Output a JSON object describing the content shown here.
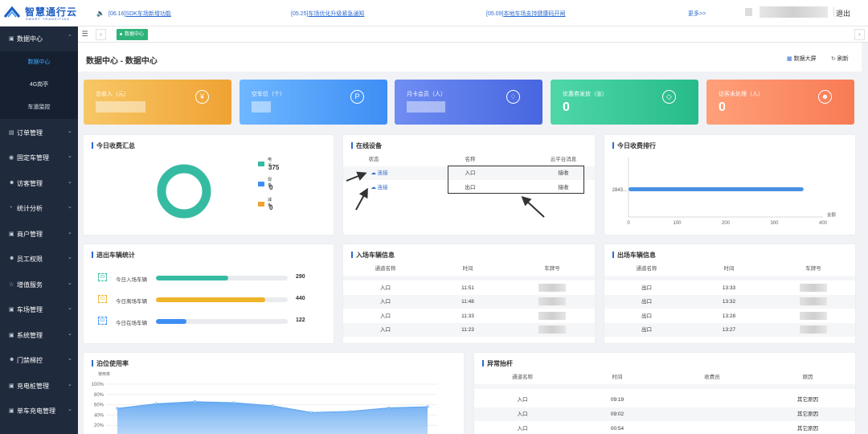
{
  "brand": {
    "name": "智慧通行云",
    "tagline": "SMART TRANSITING"
  },
  "notices": [
    {
      "date": "[06.16]",
      "text": "SDK车场新增功能"
    },
    {
      "date": "[05.25]",
      "text": "车场优化升级紧急通知"
    },
    {
      "date": "[05.09]",
      "text": "本地车场支持健康码开闸"
    }
  ],
  "header": {
    "more_label": "更多>>",
    "logout_label": "退出"
  },
  "sidebar": {
    "groups": [
      {
        "label": "数据中心",
        "icon": "chart-icon",
        "expanded": true,
        "children": [
          {
            "label": "数据中心",
            "active": true
          },
          {
            "label": "4G岗亭"
          },
          {
            "label": "车道监控"
          }
        ]
      },
      {
        "label": "订单管理",
        "icon": "order-icon"
      },
      {
        "label": "固定车管理",
        "icon": "car-icon"
      },
      {
        "label": "访客管理",
        "icon": "visitor-icon"
      },
      {
        "label": "统计分析",
        "icon": "stats-icon"
      },
      {
        "label": "商户管理",
        "icon": "store-icon"
      },
      {
        "label": "员工权限",
        "icon": "staff-icon"
      },
      {
        "label": "增值服务",
        "icon": "star-icon"
      },
      {
        "label": "车场管理",
        "icon": "parking-icon"
      },
      {
        "label": "系统管理",
        "icon": "system-icon"
      },
      {
        "label": "门禁梯控",
        "icon": "door-icon"
      },
      {
        "label": "充电桩管理",
        "icon": "charger-icon"
      },
      {
        "label": "单车充电管理",
        "icon": "bike-icon"
      }
    ]
  },
  "tabbar": {
    "active_tab": "数据中心"
  },
  "page": {
    "title": "数据中心 - 数据中心",
    "big_screen_label": "数据大屏",
    "refresh_label": "刷新"
  },
  "stats": [
    {
      "title": "总收入（元）",
      "value": "",
      "icon": "yen-icon",
      "color_from": "#f7c766",
      "color_to": "#f0a233"
    },
    {
      "title": "空车位（个）",
      "value": "",
      "icon": "parking-p-icon",
      "color_from": "#6fb7ff",
      "color_to": "#3d8ef5"
    },
    {
      "title": "月卡会员（人）",
      "value": "",
      "icon": "vip-icon",
      "color_from": "#6f8df2",
      "color_to": "#4766e0"
    },
    {
      "title": "优惠券发放（张）",
      "value": "0",
      "icon": "coupon-icon",
      "color_from": "#4fd7a8",
      "color_to": "#27bb8a"
    },
    {
      "title": "访客未处理（人）",
      "value": "0",
      "icon": "visitor-icon",
      "color_from": "#ffa07a",
      "color_to": "#f87b54"
    }
  ],
  "today_fee_summary": {
    "title": "今日收费汇总",
    "legend": [
      {
        "label": "电子",
        "value": "375",
        "color": "#36bba3"
      },
      {
        "label": "现金",
        "value": "0",
        "color": "#3d8ef5"
      },
      {
        "label": "减免",
        "value": "0",
        "color": "#f0a233"
      }
    ]
  },
  "online_devices": {
    "title": "在线设备",
    "columns": [
      "状态",
      "名称",
      "云平台消息"
    ],
    "rows": [
      {
        "status": "连接",
        "name": "入口",
        "message": "接收"
      },
      {
        "status": "连接",
        "name": "出口",
        "message": "接收"
      }
    ]
  },
  "fee_ranking": {
    "title": "今日收费排行",
    "chart_data": {
      "type": "bar",
      "orientation": "horizontal",
      "categories": [
        "2843..."
      ],
      "values": [
        360
      ],
      "xlim": [
        0,
        400
      ],
      "xticks": [
        "0",
        "100",
        "200",
        "300",
        "400"
      ],
      "xlabel": "金额"
    }
  },
  "vehicle_stats": {
    "title": "进出车辆统计",
    "items": [
      {
        "label": "今日入场车辆",
        "value": "290",
        "fraction": 0.55,
        "color": "#36bba3",
        "icon": "car-in-icon"
      },
      {
        "label": "今日离场车辆",
        "value": "440",
        "fraction": 0.83,
        "color": "#f0b429",
        "icon": "car-out-icon"
      },
      {
        "label": "今日在场车辆",
        "value": "122",
        "fraction": 0.23,
        "color": "#3d8ef5",
        "icon": "car-in-lot-icon"
      }
    ]
  },
  "entry_info": {
    "title": "入场车辆信息",
    "columns": [
      "通道名称",
      "时间",
      "车牌号"
    ],
    "rows": [
      {
        "channel": "入口",
        "time": "11:51"
      },
      {
        "channel": "入口",
        "time": "11:48"
      },
      {
        "channel": "入口",
        "time": "11:33"
      },
      {
        "channel": "入口",
        "time": "11:23"
      }
    ]
  },
  "exit_info": {
    "title": "出场车辆信息",
    "columns": [
      "通道名称",
      "时间",
      "车牌号"
    ],
    "rows": [
      {
        "channel": "出口",
        "time": "13:33"
      },
      {
        "channel": "出口",
        "time": "13:32"
      },
      {
        "channel": "出口",
        "time": "13:28"
      },
      {
        "channel": "出口",
        "time": "13:27"
      }
    ]
  },
  "occupancy": {
    "title": "泊位使用率",
    "chart_data": {
      "type": "area",
      "ylabel": "使用率",
      "yticks": [
        "100%",
        "80%",
        "60%",
        "40%",
        "20%"
      ],
      "ylim": [
        0,
        100
      ],
      "values": [
        53,
        62,
        66,
        64,
        58,
        45,
        47,
        54,
        56
      ]
    }
  },
  "abnormal_lift": {
    "title": "异常抬杆",
    "columns": [
      "通道名称",
      "时间",
      "收费员",
      "原因"
    ],
    "rows": [
      {
        "channel": "入口",
        "time": "09:19",
        "cashier": "",
        "reason": "其它原因"
      },
      {
        "channel": "入口",
        "time": "09:02",
        "cashier": "",
        "reason": "其它原因"
      },
      {
        "channel": "入口",
        "time": "00:54",
        "cashier": "",
        "reason": "其它原因"
      }
    ]
  }
}
